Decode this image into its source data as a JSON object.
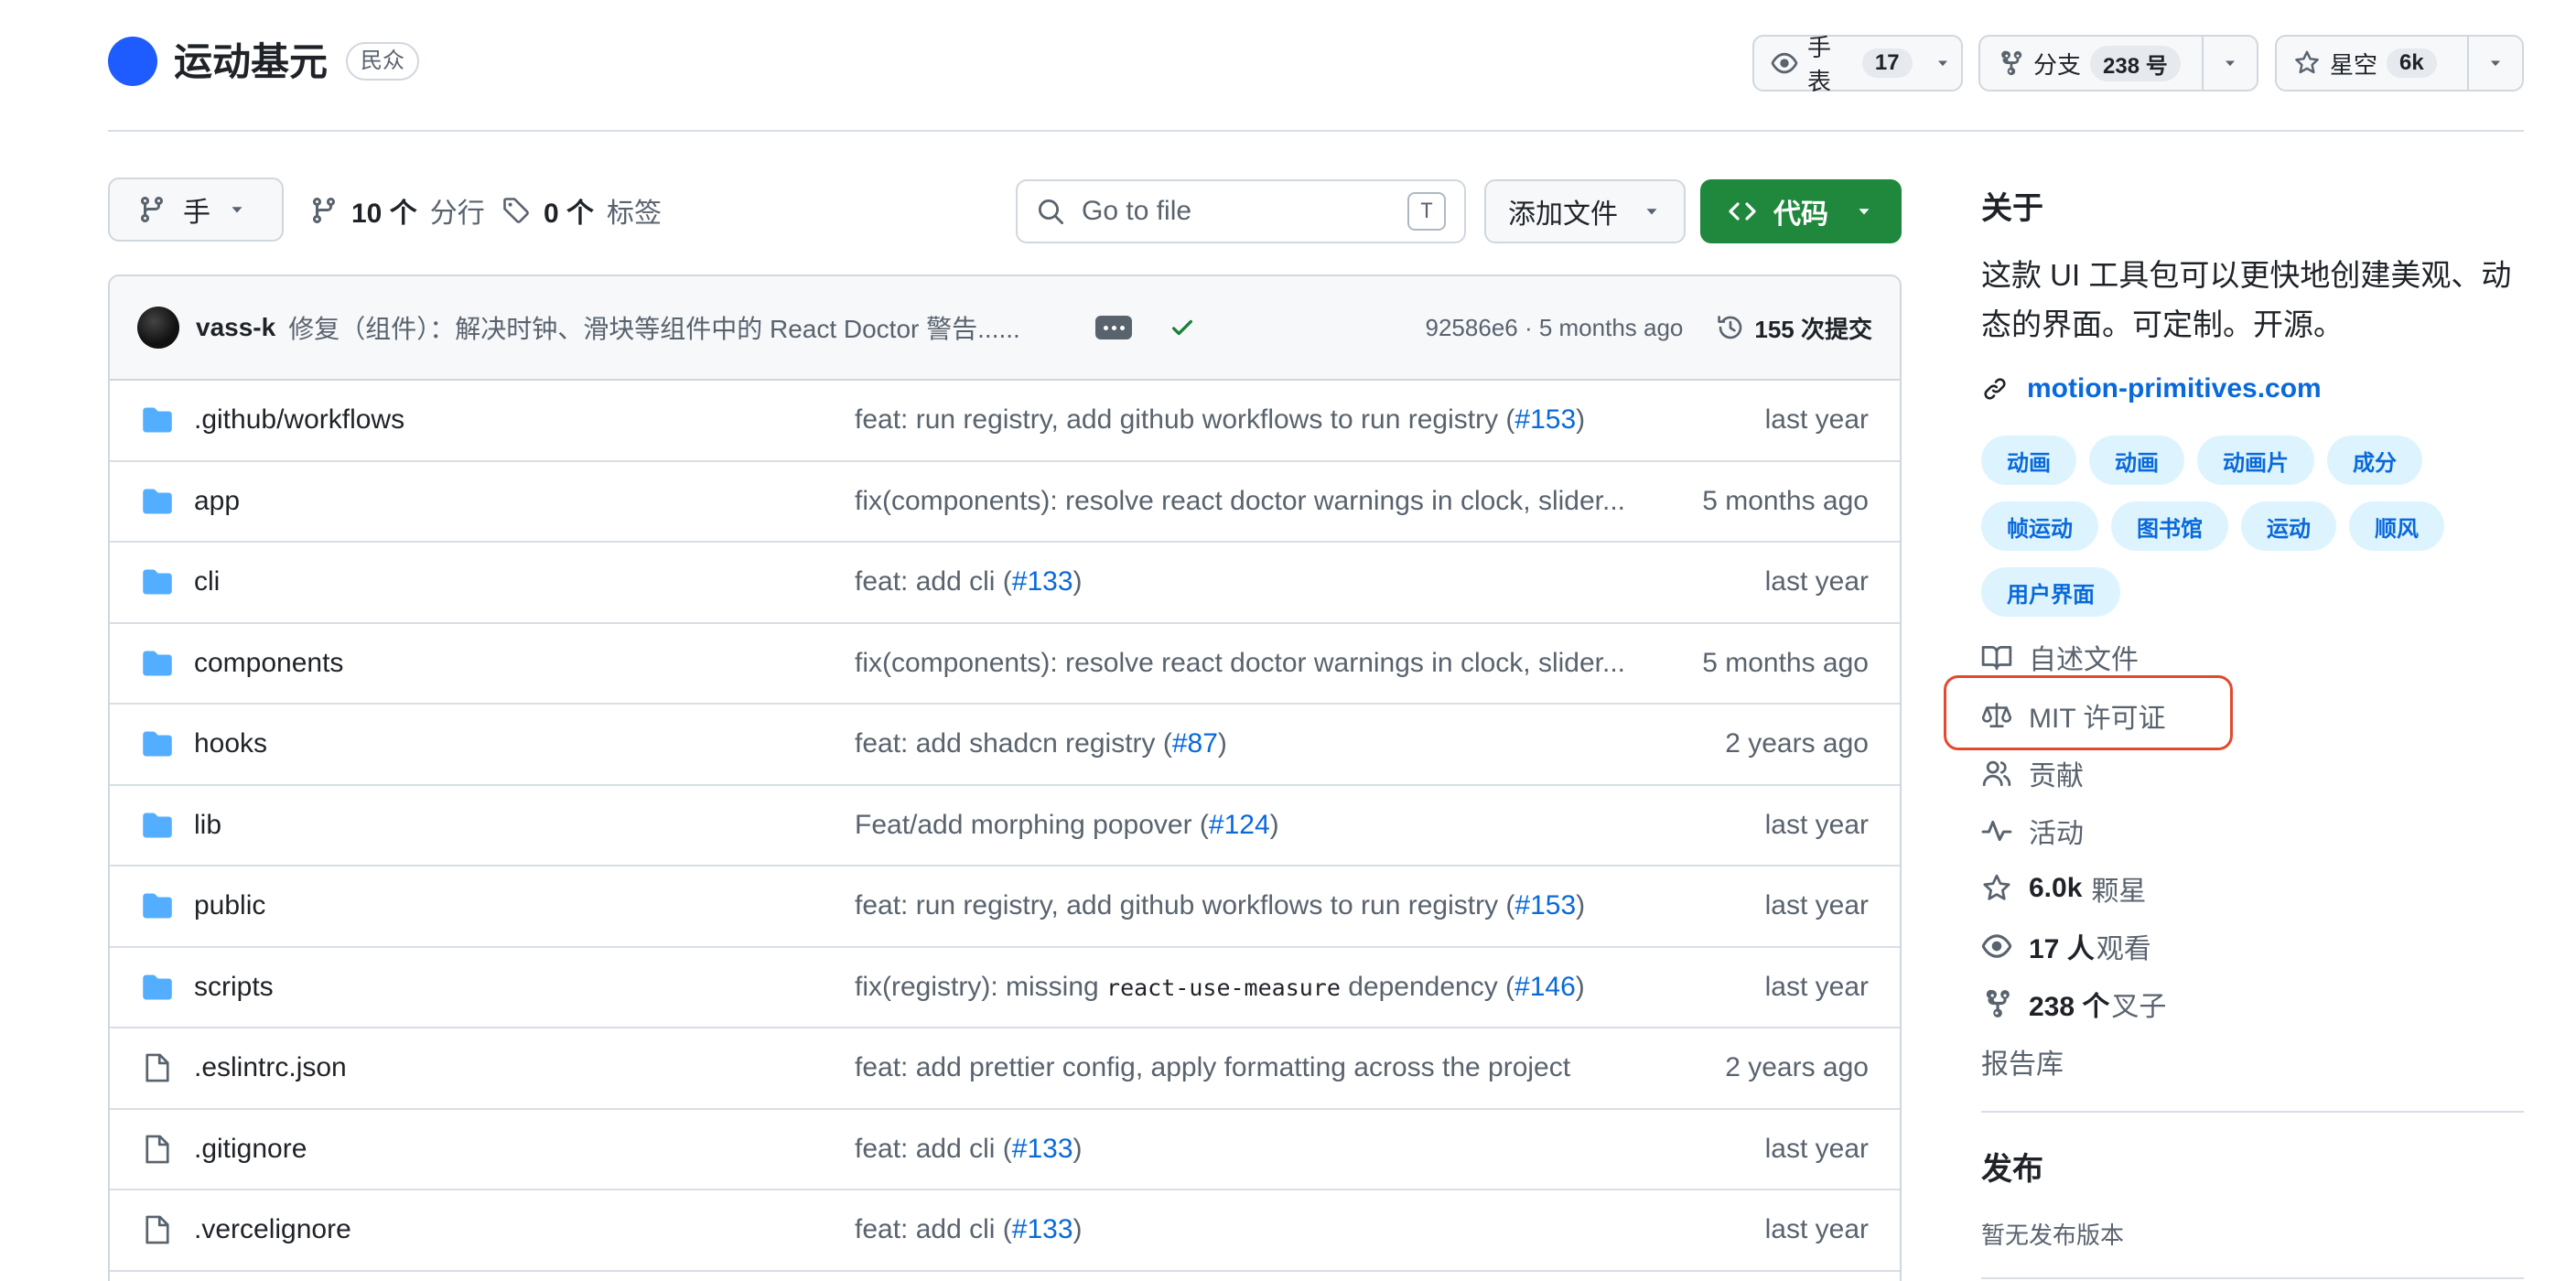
{
  "header": {
    "repo_name": "运动基元",
    "visibility": "民众",
    "watch": {
      "label": "手表",
      "count": "17"
    },
    "fork": {
      "label": "分支",
      "count": "238 号"
    },
    "star": {
      "label": "星空",
      "count": "6k"
    }
  },
  "toolbar": {
    "branch": "手",
    "branches_count": "10 个",
    "branches_label": "分行",
    "tags_count": "0 个",
    "tags_label": "标签",
    "search_placeholder": "Go to file",
    "search_kbd": "T",
    "add_file_label": "添加文件",
    "code_label": "代码"
  },
  "last_commit": {
    "author": "vass-k",
    "message": "修复（组件）：解决时钟、滑块等组件中的 React Doctor 警告......",
    "sha_time": "92586e6 · 5 months ago",
    "commits": "155 次提交"
  },
  "files": [
    {
      "type": "folder",
      "name": ".github/workflows",
      "msg_pre": "feat: run registry, add github workflows to run registry (",
      "link": "#153",
      "msg_post": ")",
      "date": "last year"
    },
    {
      "type": "folder",
      "name": "app",
      "msg_pre": "fix(components): resolve react doctor warnings in clock, slider...",
      "link": "",
      "msg_post": "",
      "date": "5 months ago"
    },
    {
      "type": "folder",
      "name": "cli",
      "msg_pre": "feat: add cli (",
      "link": "#133",
      "msg_post": ")",
      "date": "last year"
    },
    {
      "type": "folder",
      "name": "components",
      "msg_pre": "fix(components): resolve react doctor warnings in clock, slider...",
      "link": "",
      "msg_post": "",
      "date": "5 months ago"
    },
    {
      "type": "folder",
      "name": "hooks",
      "msg_pre": "feat: add shadcn registry (",
      "link": "#87",
      "msg_post": ")",
      "date": "2 years ago"
    },
    {
      "type": "folder",
      "name": "lib",
      "msg_pre": "Feat/add morphing popover (",
      "link": "#124",
      "msg_post": ")",
      "date": "last year"
    },
    {
      "type": "folder",
      "name": "public",
      "msg_pre": "feat: run registry, add github workflows to run registry (",
      "link": "#153",
      "msg_post": ")",
      "date": "last year"
    },
    {
      "type": "folder",
      "name": "scripts",
      "msg_pre": "fix(registry): missing ",
      "code": "react-use-measure",
      "msg_mid": " dependency (",
      "link": "#146",
      "msg_post": ")",
      "date": "last year"
    },
    {
      "type": "file",
      "name": ".eslintrc.json",
      "msg_pre": "feat: add prettier config, apply formatting across the project",
      "link": "",
      "msg_post": "",
      "date": "2 years ago"
    },
    {
      "type": "file",
      "name": ".gitignore",
      "msg_pre": "feat: add cli (",
      "link": "#133",
      "msg_post": ")",
      "date": "last year"
    },
    {
      "type": "file",
      "name": ".vercelignore",
      "msg_pre": "feat: add cli (",
      "link": "#133",
      "msg_post": ")",
      "date": "last year"
    }
  ],
  "about": {
    "title": "关于",
    "description": "这款 UI 工具包可以更快地创建美观、动态的界面。可定制。开源。",
    "website": "motion-primitives.com",
    "topics": [
      "动画",
      "动画",
      "动画片",
      "成分",
      "帧运动",
      "图书馆",
      "运动",
      "顺风",
      "用户界面"
    ],
    "readme": "自述文件",
    "license": "MIT 许可证",
    "contributing": "贡献",
    "activity": "活动",
    "stars_count": "6.0k",
    "stars_label": "颗星",
    "watchers_count": "17 人",
    "watchers_label": "观看",
    "forks_count": "238 个",
    "forks_label": "叉子",
    "report": "报告库"
  },
  "releases": {
    "title": "发布",
    "empty": "暂无发布版本"
  },
  "colors": {
    "accent_blue": "#0969da",
    "code_green": "#1f883d",
    "highlight_red": "#e2492f",
    "folder_blue": "#54aeff"
  }
}
